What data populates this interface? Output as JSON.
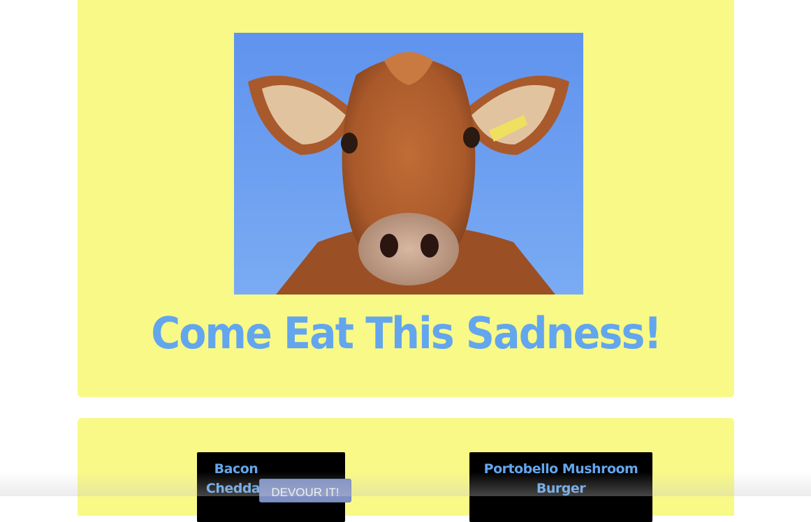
{
  "hero": {
    "image_alt": "cow face against blue sky",
    "title": "Come Eat This Sadness!"
  },
  "menu": {
    "burgers": [
      {
        "name": "Bacon Cheddar",
        "button_label": "DEVOUR IT!"
      },
      {
        "name": "Portobello Mushroom Burger"
      }
    ]
  },
  "colors": {
    "panel_background": "#f8f987",
    "title_blue": "#63a6ed",
    "card_background": "#000000",
    "button_background": "#7e8fc5",
    "sky": "#6f9ff0",
    "cow_fur": "#b4622e"
  }
}
